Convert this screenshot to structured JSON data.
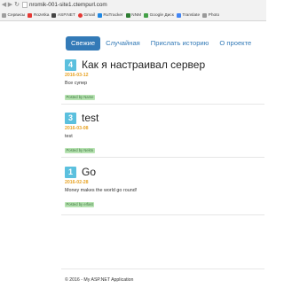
{
  "browser": {
    "url": "nromik-001-site1.ctempurl.com",
    "bookmarks": [
      {
        "label": "Сервисы",
        "icon": "apps-icon",
        "cls": "apps"
      },
      {
        "label": "Rozetka",
        "icon": "rozetka-icon",
        "cls": "r"
      },
      {
        "label": "ASP.NET",
        "icon": "aspnet-icon",
        "cls": "k"
      },
      {
        "label": "Gmail",
        "icon": "gmail-icon",
        "cls": "g"
      },
      {
        "label": "RuTracker",
        "icon": "rutracker-icon",
        "cls": "rt"
      },
      {
        "label": "NNM",
        "icon": "nnm-icon",
        "cls": "n"
      },
      {
        "label": "Google Диск",
        "icon": "google-drive-icon",
        "cls": "gd"
      },
      {
        "label": "Translate",
        "icon": "translate-icon",
        "cls": "tr"
      },
      {
        "label": "Photo",
        "icon": "photo-icon",
        "cls": "ph"
      }
    ]
  },
  "nav": {
    "items": [
      {
        "label": "Свежие",
        "active": true
      },
      {
        "label": "Случайная",
        "active": false
      },
      {
        "label": "Прислать историю",
        "active": false
      },
      {
        "label": "О проекте",
        "active": false
      }
    ]
  },
  "posts": [
    {
      "number": "4",
      "title": "Как я настраивал сервер",
      "date": "2016-03-12",
      "body": "Все супер",
      "author": "Posted by Name"
    },
    {
      "number": "3",
      "title": "test",
      "date": "2016-03-08",
      "body": "test",
      "author": "Posted by Nekto"
    },
    {
      "number": "1",
      "title": "Go",
      "date": "2016-02-28",
      "body": "Money makes the world go round!",
      "author": "Posted by erfast"
    }
  ],
  "footer": {
    "text": "© 2016 - My ASP.NET Application"
  },
  "colors": {
    "primary": "#337ab7",
    "badge": "#5bc0de",
    "date": "#e8a325",
    "author_bg": "#b7e3b2"
  }
}
